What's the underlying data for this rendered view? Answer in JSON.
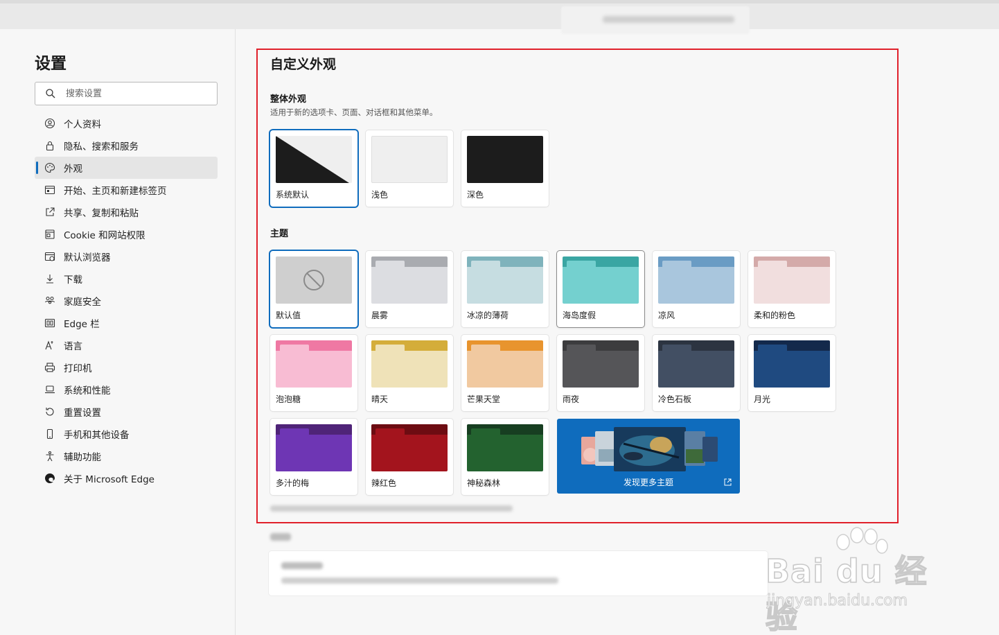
{
  "settings": {
    "title": "设置",
    "search_placeholder": "搜索设置",
    "nav": [
      {
        "label": "个人资料",
        "icon": "profile-icon"
      },
      {
        "label": "隐私、搜索和服务",
        "icon": "lock-icon"
      },
      {
        "label": "外观",
        "icon": "palette-icon",
        "active": true
      },
      {
        "label": "开始、主页和新建标签页",
        "icon": "home-tab-icon"
      },
      {
        "label": "共享、复制和粘贴",
        "icon": "share-icon"
      },
      {
        "label": "Cookie 和网站权限",
        "icon": "cookie-icon"
      },
      {
        "label": "默认浏览器",
        "icon": "browser-icon"
      },
      {
        "label": "下载",
        "icon": "download-icon"
      },
      {
        "label": "家庭安全",
        "icon": "family-icon"
      },
      {
        "label": "Edge 栏",
        "icon": "edge-bar-icon"
      },
      {
        "label": "语言",
        "icon": "language-icon"
      },
      {
        "label": "打印机",
        "icon": "printer-icon"
      },
      {
        "label": "系统和性能",
        "icon": "laptop-icon"
      },
      {
        "label": "重置设置",
        "icon": "reset-icon"
      },
      {
        "label": "手机和其他设备",
        "icon": "phone-icon"
      },
      {
        "label": "辅助功能",
        "icon": "accessibility-icon"
      },
      {
        "label": "关于 Microsoft Edge",
        "icon": "edge-logo-icon"
      }
    ]
  },
  "appearance": {
    "title": "自定义外观",
    "overall": {
      "title": "整体外观",
      "description": "适用于新的选项卡、页面、对话框和其他菜单。",
      "options": [
        {
          "label": "系统默认",
          "selected": true
        },
        {
          "label": "浅色"
        },
        {
          "label": "深色"
        }
      ]
    },
    "themes": {
      "title": "主题",
      "items": [
        {
          "label": "默认值",
          "selected": true,
          "bar": "#cfcfcf",
          "body": "#cfcfcf"
        },
        {
          "label": "晨雾",
          "bar": "#a9abb0",
          "body": "#dcdde1"
        },
        {
          "label": "冰凉的薄荷",
          "bar": "#7fb3bc",
          "body": "#c6dde1"
        },
        {
          "label": "海岛度假",
          "bar": "#3aa6a3",
          "body": "#74d0cf"
        },
        {
          "label": "凉风",
          "bar": "#6a9cc4",
          "body": "#a9c6dd"
        },
        {
          "label": "柔和的粉色",
          "bar": "#d4aaa9",
          "body": "#f1dede"
        },
        {
          "label": "泡泡糖",
          "bar": "#ef78a3",
          "body": "#f8bcd3"
        },
        {
          "label": "晴天",
          "bar": "#d4ad3a",
          "body": "#efe2b8"
        },
        {
          "label": "芒果天堂",
          "bar": "#e8942e",
          "body": "#f1c9a0"
        },
        {
          "label": "雨夜",
          "bar": "#3c3c3e",
          "body": "#555558"
        },
        {
          "label": "冷色石板",
          "bar": "#2c3441",
          "body": "#424f63"
        },
        {
          "label": "月光",
          "bar": "#13294b",
          "body": "#1f4a80"
        },
        {
          "label": "多汁的梅",
          "bar": "#4f2478",
          "body": "#6e36b4"
        },
        {
          "label": "辣红色",
          "bar": "#6d0c12",
          "body": "#a3141d"
        },
        {
          "label": "神秘森林",
          "bar": "#173e21",
          "body": "#23622f"
        }
      ],
      "discover_label": "发现更多主题"
    }
  },
  "watermark": {
    "brand": "Bai du 经验",
    "url": "jingyan.baidu.com"
  }
}
